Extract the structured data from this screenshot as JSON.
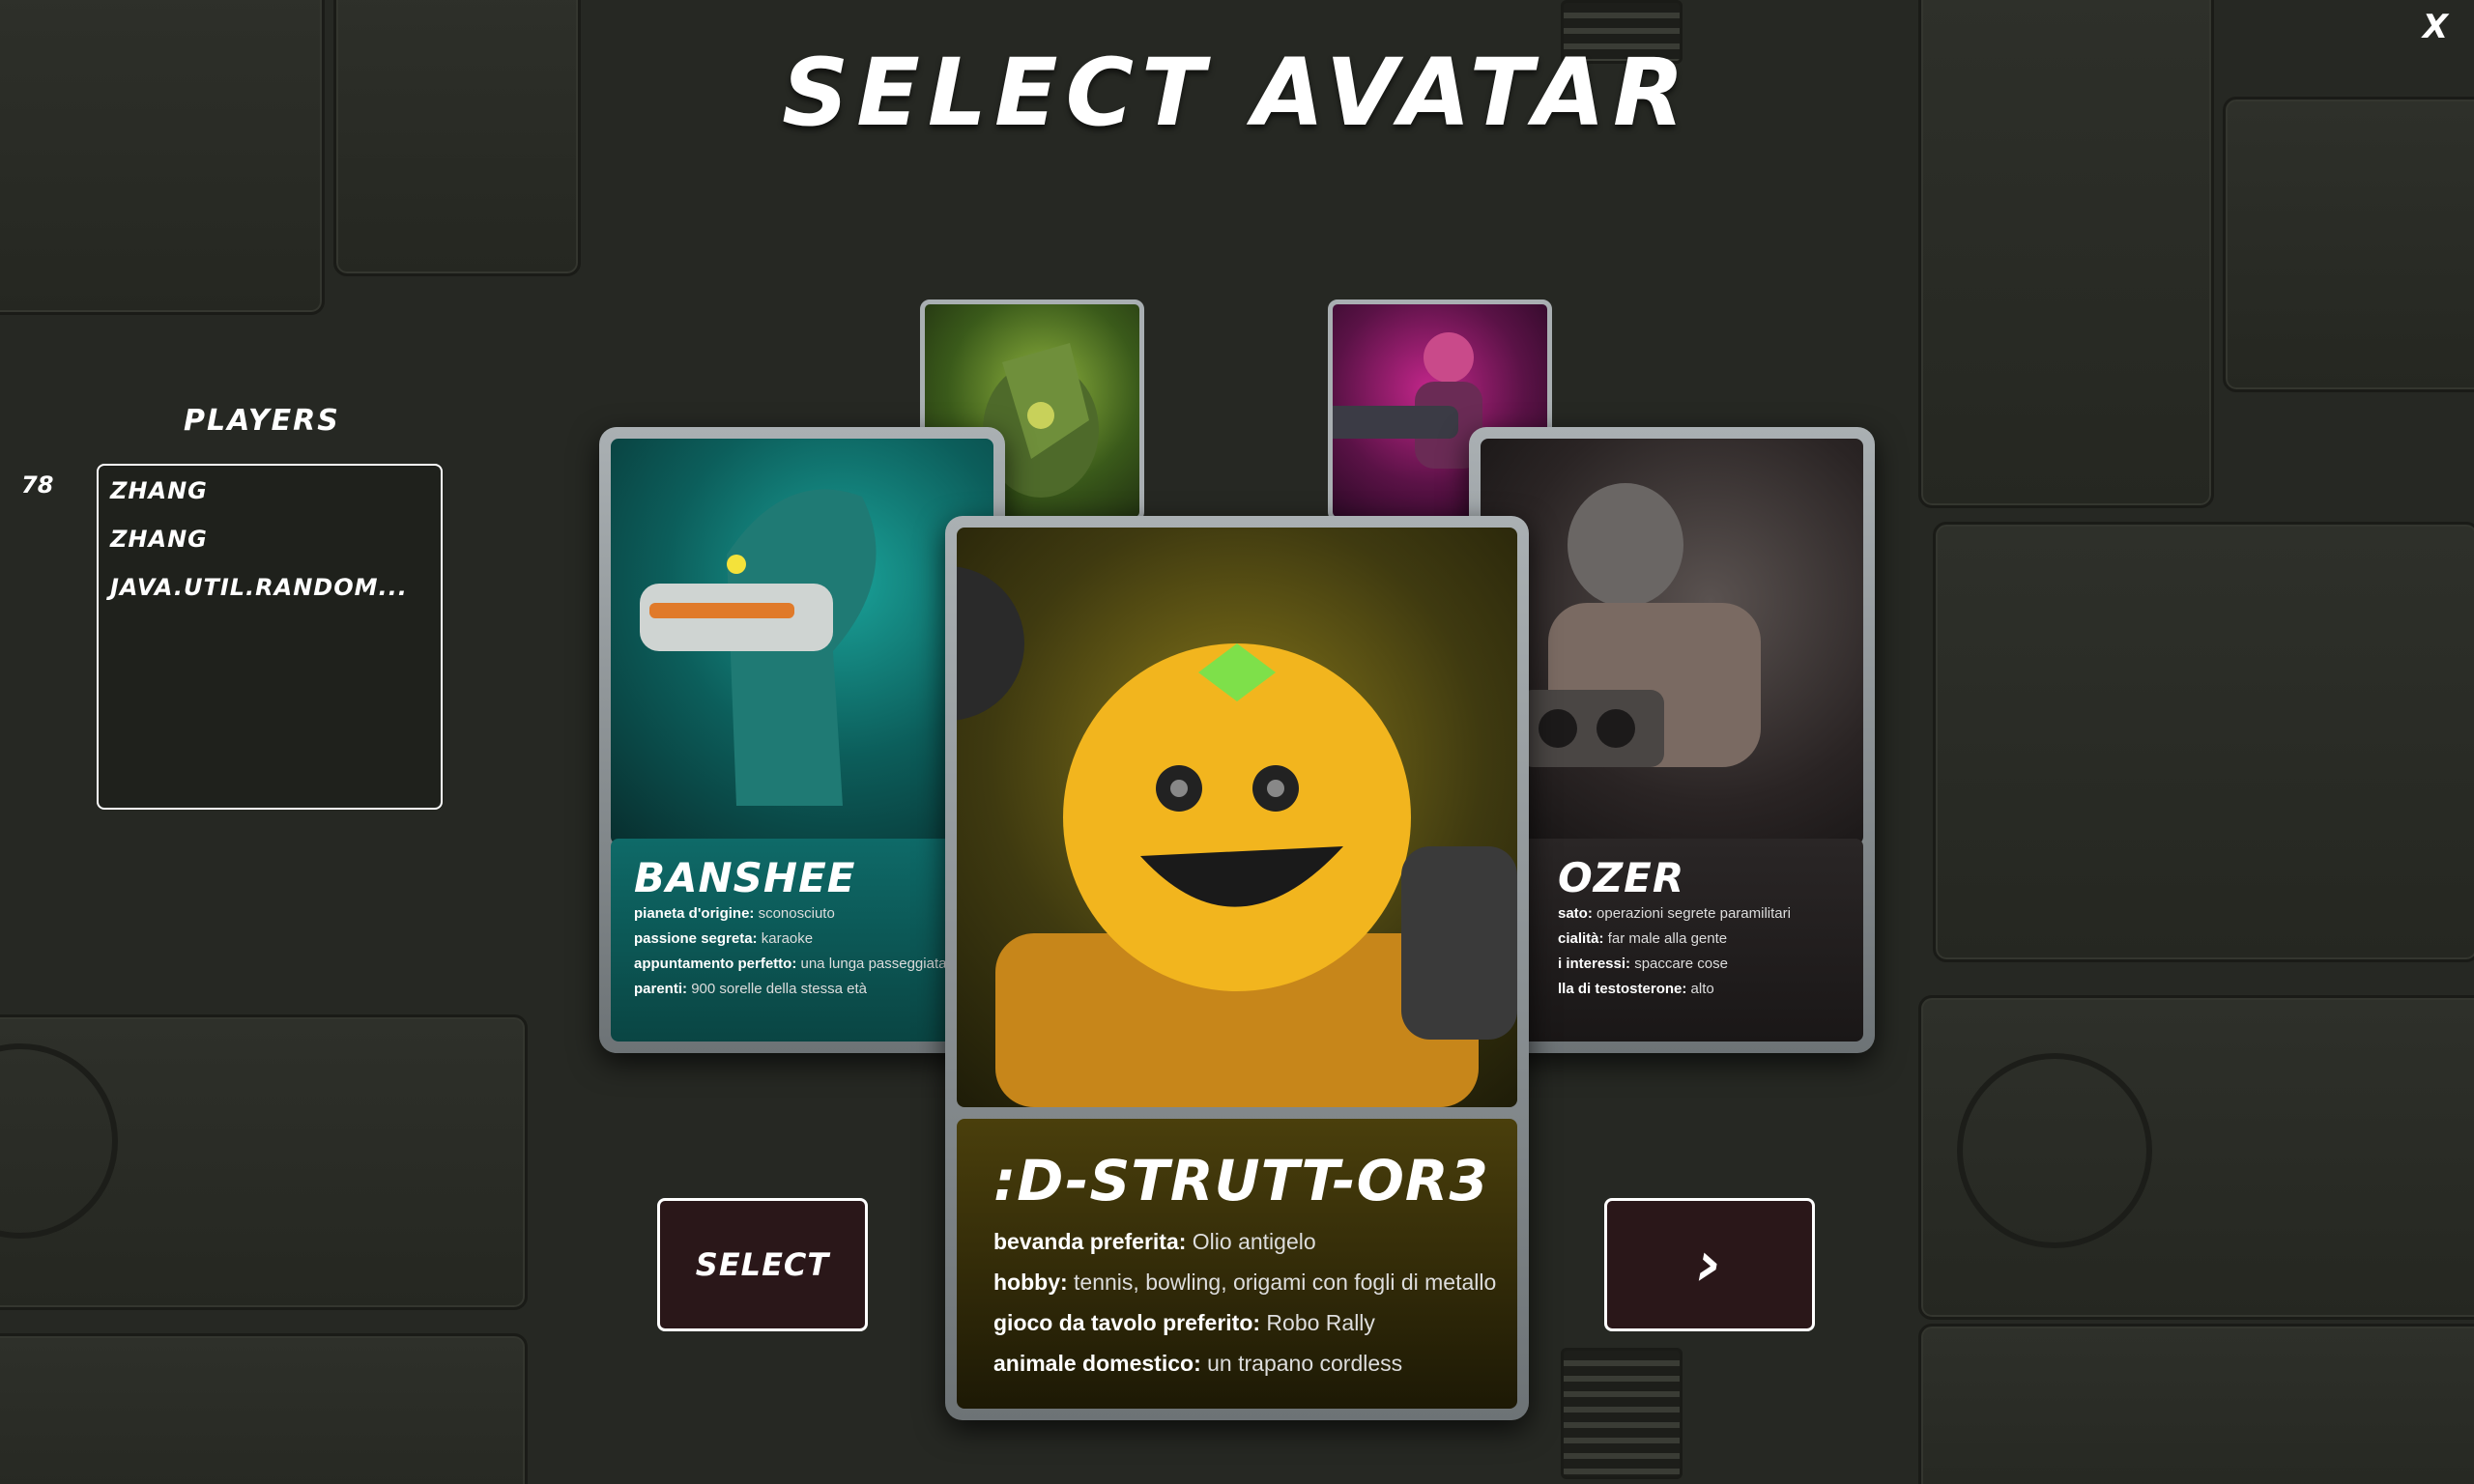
{
  "header": {
    "title": "SELECT AVATAR",
    "close_label": "X"
  },
  "players": {
    "title": "PLAYERS",
    "count": "78",
    "list": [
      "ZHANG",
      "ZHANG",
      "JAVA.UTIL.RANDOM..."
    ]
  },
  "cards": {
    "left": {
      "name": "BANSHEE",
      "lines": [
        {
          "k": "pianeta d'origine:",
          "v": "sconosciuto"
        },
        {
          "k": "passione segreta:",
          "v": "karaoke"
        },
        {
          "k": "appuntamento perfetto:",
          "v": "una lunga passeggiata vicino all'oceano, o nell'oceano"
        },
        {
          "k": "parenti:",
          "v": "900 sorelle della stessa età"
        }
      ]
    },
    "right": {
      "name": "OZER",
      "lines": [
        {
          "k": "sato:",
          "v": "operazioni segrete paramilitari"
        },
        {
          "k": "cialità:",
          "v": "far male alla gente"
        },
        {
          "k": "i interessi:",
          "v": "spaccare cose"
        },
        {
          "k": "lla di testosterone:",
          "v": "alto"
        }
      ]
    },
    "center": {
      "name": ":D-STRUTT-OR3",
      "lines": [
        {
          "k": "bevanda preferita:",
          "v": "Olio antigelo"
        },
        {
          "k": "hobby:",
          "v": "tennis, bowling, origami con fogli di metallo"
        },
        {
          "k": "gioco da tavolo preferito:",
          "v": "Robo Rally"
        },
        {
          "k": "animale domestico:",
          "v": "un trapano cordless"
        }
      ]
    }
  },
  "actions": {
    "select_label": "SELECT",
    "next_label": "›"
  },
  "colors": {
    "button_bg": "#2a1719",
    "banshee_teal": "#0b5b5a",
    "strutt_yellow": "#e0a81a",
    "dozer_dark": "#2a2626"
  }
}
